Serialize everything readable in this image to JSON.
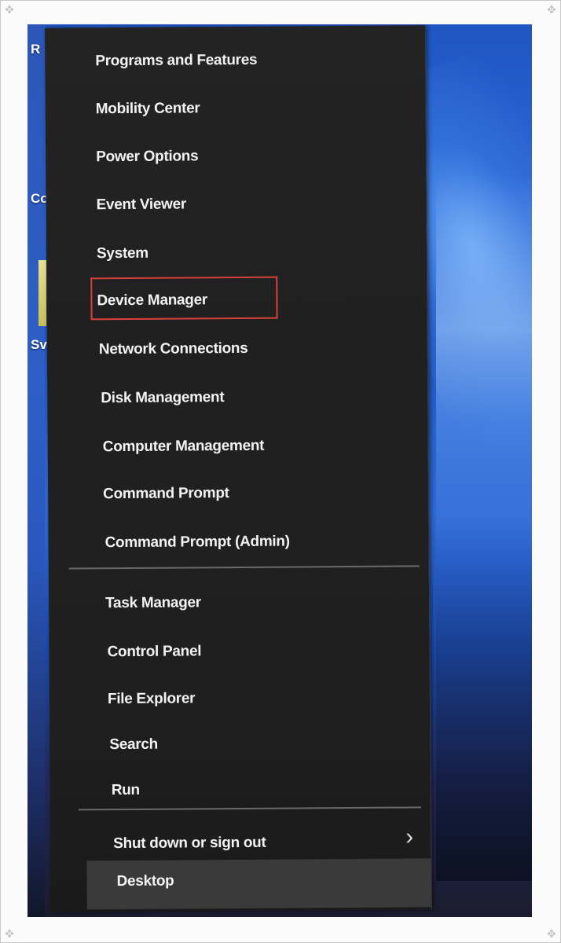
{
  "menu": {
    "items": [
      {
        "id": "programs-and-features",
        "label": "Programs and Features"
      },
      {
        "id": "mobility-center",
        "label": "Mobility Center"
      },
      {
        "id": "power-options",
        "label": "Power Options"
      },
      {
        "id": "event-viewer",
        "label": "Event Viewer"
      },
      {
        "id": "system",
        "label": "System"
      },
      {
        "id": "device-manager",
        "label": "Device Manager"
      },
      {
        "id": "network-connections",
        "label": "Network Connections"
      },
      {
        "id": "disk-management",
        "label": "Disk Management"
      },
      {
        "id": "computer-management",
        "label": "Computer Management"
      },
      {
        "id": "command-prompt",
        "label": "Command Prompt"
      },
      {
        "id": "command-prompt-admin",
        "label": "Command Prompt (Admin)"
      },
      {
        "id": "task-manager",
        "label": "Task Manager"
      },
      {
        "id": "control-panel",
        "label": "Control Panel"
      },
      {
        "id": "file-explorer",
        "label": "File Explorer"
      },
      {
        "id": "search",
        "label": "Search"
      },
      {
        "id": "run",
        "label": "Run"
      },
      {
        "id": "shut-down-or-sign-out",
        "label": "Shut down or sign out"
      },
      {
        "id": "desktop",
        "label": "Desktop"
      }
    ],
    "highlighted_item": "Device Manager",
    "submenu_icon": "chevron-right-icon"
  },
  "desktop": {
    "partial_labels": [
      "R",
      "Co",
      "Sv"
    ]
  },
  "colors": {
    "menu_background": "#202020",
    "menu_text": "#f2f2f2",
    "highlight_border": "#d6423a",
    "desktop_row": "#3a3a3a",
    "wallpaper_blue": "#2156c2"
  }
}
